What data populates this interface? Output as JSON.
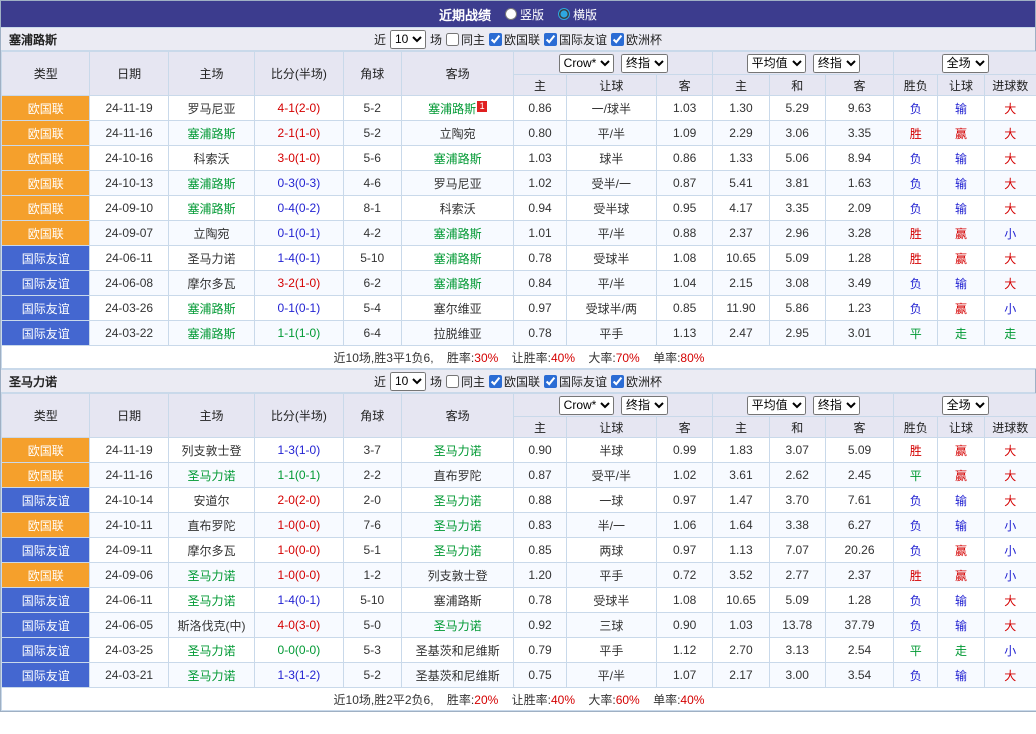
{
  "topbar": {
    "title": "近期战绩",
    "radio_vertical": "竖版",
    "radio_horizontal": "横版"
  },
  "filters": {
    "near_label": "近",
    "count_value": "10",
    "games_label": "场",
    "same_home_label": "同主",
    "comp_nations": "欧国联",
    "comp_friendly": "国际友谊",
    "comp_euro": "欧洲杯"
  },
  "selects": {
    "bookmaker": "Crow*",
    "final_odds": "终指",
    "average": "平均值",
    "full_match": "全场"
  },
  "columns": {
    "type": "类型",
    "date": "日期",
    "home": "主场",
    "score": "比分(半场)",
    "corner": "角球",
    "away": "客场",
    "ah_home": "主",
    "ah_line": "让球",
    "ah_away": "客",
    "eu_home": "主",
    "eu_draw": "和",
    "eu_away": "客",
    "wdl": "胜负",
    "handicap": "让球",
    "goals": "进球数"
  },
  "colors": {
    "topbar_bg": "#3c3c8e",
    "nations_orange": "#f5a02c",
    "friendly_blue": "#4467d0",
    "team_green": "#009933",
    "win_red": "#d40000",
    "loss_blue": "#2323d2"
  },
  "sections": [
    {
      "team": "塞浦路斯",
      "rows": [
        {
          "type": "欧国联",
          "tcls": "c-orange",
          "date": "24-11-19",
          "home": "罗马尼亚",
          "hcls": "",
          "score": "4-1(2-0)",
          "scls": "t-red",
          "corner": "5-2",
          "away": "塞浦路斯",
          "acls": "t-green",
          "badge": "1",
          "ah_h": "0.86",
          "ah_l": "一/球半",
          "ah_a": "1.03",
          "eu_h": "1.30",
          "eu_d": "5.29",
          "eu_a": "9.63",
          "wdl": "负",
          "wdlc": "t-blue",
          "hc": "输",
          "hcc": "t-blue",
          "ou": "大",
          "ouc": "t-red"
        },
        {
          "type": "欧国联",
          "tcls": "c-orange",
          "date": "24-11-16",
          "home": "塞浦路斯",
          "hcls": "t-green",
          "score": "2-1(1-0)",
          "scls": "t-red",
          "corner": "5-2",
          "away": "立陶宛",
          "acls": "",
          "ah_h": "0.80",
          "ah_l": "平/半",
          "ah_a": "1.09",
          "eu_h": "2.29",
          "eu_d": "3.06",
          "eu_a": "3.35",
          "wdl": "胜",
          "wdlc": "t-red",
          "hc": "赢",
          "hcc": "t-red",
          "ou": "大",
          "ouc": "t-red"
        },
        {
          "type": "欧国联",
          "tcls": "c-orange",
          "date": "24-10-16",
          "home": "科索沃",
          "hcls": "",
          "score": "3-0(1-0)",
          "scls": "t-red",
          "corner": "5-6",
          "away": "塞浦路斯",
          "acls": "t-green",
          "ah_h": "1.03",
          "ah_l": "球半",
          "ah_a": "0.86",
          "eu_h": "1.33",
          "eu_d": "5.06",
          "eu_a": "8.94",
          "wdl": "负",
          "wdlc": "t-blue",
          "hc": "输",
          "hcc": "t-blue",
          "ou": "大",
          "ouc": "t-red"
        },
        {
          "type": "欧国联",
          "tcls": "c-orange",
          "date": "24-10-13",
          "home": "塞浦路斯",
          "hcls": "t-green",
          "score": "0-3(0-3)",
          "scls": "t-blue",
          "corner": "4-6",
          "away": "罗马尼亚",
          "acls": "",
          "ah_h": "1.02",
          "ah_l": "受半/一",
          "ah_a": "0.87",
          "eu_h": "5.41",
          "eu_d": "3.81",
          "eu_a": "1.63",
          "wdl": "负",
          "wdlc": "t-blue",
          "hc": "输",
          "hcc": "t-blue",
          "ou": "大",
          "ouc": "t-red"
        },
        {
          "type": "欧国联",
          "tcls": "c-orange",
          "date": "24-09-10",
          "home": "塞浦路斯",
          "hcls": "t-green",
          "score": "0-4(0-2)",
          "scls": "t-blue",
          "corner": "8-1",
          "away": "科索沃",
          "acls": "",
          "ah_h": "0.94",
          "ah_l": "受半球",
          "ah_a": "0.95",
          "eu_h": "4.17",
          "eu_d": "3.35",
          "eu_a": "2.09",
          "wdl": "负",
          "wdlc": "t-blue",
          "hc": "输",
          "hcc": "t-blue",
          "ou": "大",
          "ouc": "t-red"
        },
        {
          "type": "欧国联",
          "tcls": "c-orange",
          "date": "24-09-07",
          "home": "立陶宛",
          "hcls": "",
          "score": "0-1(0-1)",
          "scls": "t-blue",
          "corner": "4-2",
          "away": "塞浦路斯",
          "acls": "t-green",
          "ah_h": "1.01",
          "ah_l": "平/半",
          "ah_a": "0.88",
          "eu_h": "2.37",
          "eu_d": "2.96",
          "eu_a": "3.28",
          "wdl": "胜",
          "wdlc": "t-red",
          "hc": "赢",
          "hcc": "t-red",
          "ou": "小",
          "ouc": "t-blue"
        },
        {
          "type": "国际友谊",
          "tcls": "c-blue",
          "date": "24-06-11",
          "home": "圣马力诺",
          "hcls": "",
          "score": "1-4(0-1)",
          "scls": "t-blue",
          "corner": "5-10",
          "away": "塞浦路斯",
          "acls": "t-green",
          "ah_h": "0.78",
          "ah_l": "受球半",
          "ah_a": "1.08",
          "eu_h": "10.65",
          "eu_d": "5.09",
          "eu_a": "1.28",
          "wdl": "胜",
          "wdlc": "t-red",
          "hc": "赢",
          "hcc": "t-red",
          "ou": "大",
          "ouc": "t-red"
        },
        {
          "type": "国际友谊",
          "tcls": "c-blue",
          "date": "24-06-08",
          "home": "摩尔多瓦",
          "hcls": "",
          "score": "3-2(1-0)",
          "scls": "t-red",
          "corner": "6-2",
          "away": "塞浦路斯",
          "acls": "t-green",
          "ah_h": "0.84",
          "ah_l": "平/半",
          "ah_a": "1.04",
          "eu_h": "2.15",
          "eu_d": "3.08",
          "eu_a": "3.49",
          "wdl": "负",
          "wdlc": "t-blue",
          "hc": "输",
          "hcc": "t-blue",
          "ou": "大",
          "ouc": "t-red"
        },
        {
          "type": "国际友谊",
          "tcls": "c-blue",
          "date": "24-03-26",
          "home": "塞浦路斯",
          "hcls": "t-green",
          "score": "0-1(0-1)",
          "scls": "t-blue",
          "corner": "5-4",
          "away": "塞尔维亚",
          "acls": "",
          "ah_h": "0.97",
          "ah_l": "受球半/两",
          "ah_a": "0.85",
          "eu_h": "11.90",
          "eu_d": "5.86",
          "eu_a": "1.23",
          "wdl": "负",
          "wdlc": "t-blue",
          "hc": "赢",
          "hcc": "t-red",
          "ou": "小",
          "ouc": "t-blue"
        },
        {
          "type": "国际友谊",
          "tcls": "c-blue",
          "date": "24-03-22",
          "home": "塞浦路斯",
          "hcls": "t-green",
          "score": "1-1(1-0)",
          "scls": "t-green",
          "corner": "6-4",
          "away": "拉脱维亚",
          "acls": "",
          "ah_h": "0.78",
          "ah_l": "平手",
          "ah_a": "1.13",
          "eu_h": "2.47",
          "eu_d": "2.95",
          "eu_a": "3.01",
          "wdl": "平",
          "wdlc": "t-green",
          "hc": "走",
          "hcc": "t-green",
          "ou": "走",
          "ouc": "t-green"
        }
      ],
      "summary": {
        "record": "近10场,胜3平1负6,",
        "win_label": "胜率:",
        "win_value": "30%",
        "hc_label": "让胜率:",
        "hc_value": "40%",
        "big_label": "大率:",
        "big_value": "70%",
        "single_label": "单率:",
        "single_value": "80%"
      }
    },
    {
      "team": "圣马力诺",
      "rows": [
        {
          "type": "欧国联",
          "tcls": "c-orange",
          "date": "24-11-19",
          "home": "列支敦士登",
          "hcls": "",
          "score": "1-3(1-0)",
          "scls": "t-blue",
          "corner": "3-7",
          "away": "圣马力诺",
          "acls": "t-green",
          "ah_h": "0.90",
          "ah_l": "半球",
          "ah_a": "0.99",
          "eu_h": "1.83",
          "eu_d": "3.07",
          "eu_a": "5.09",
          "wdl": "胜",
          "wdlc": "t-red",
          "hc": "赢",
          "hcc": "t-red",
          "ou": "大",
          "ouc": "t-red"
        },
        {
          "type": "欧国联",
          "tcls": "c-orange",
          "date": "24-11-16",
          "home": "圣马力诺",
          "hcls": "t-green",
          "score": "1-1(0-1)",
          "scls": "t-green",
          "corner": "2-2",
          "away": "直布罗陀",
          "acls": "",
          "ah_h": "0.87",
          "ah_l": "受平/半",
          "ah_a": "1.02",
          "eu_h": "3.61",
          "eu_d": "2.62",
          "eu_a": "2.45",
          "wdl": "平",
          "wdlc": "t-green",
          "hc": "赢",
          "hcc": "t-red",
          "ou": "大",
          "ouc": "t-red"
        },
        {
          "type": "国际友谊",
          "tcls": "c-blue",
          "date": "24-10-14",
          "home": "安道尔",
          "hcls": "",
          "score": "2-0(2-0)",
          "scls": "t-red",
          "corner": "2-0",
          "away": "圣马力诺",
          "acls": "t-green",
          "ah_h": "0.88",
          "ah_l": "一球",
          "ah_a": "0.97",
          "eu_h": "1.47",
          "eu_d": "3.70",
          "eu_a": "7.61",
          "wdl": "负",
          "wdlc": "t-blue",
          "hc": "输",
          "hcc": "t-blue",
          "ou": "大",
          "ouc": "t-red"
        },
        {
          "type": "欧国联",
          "tcls": "c-orange",
          "date": "24-10-11",
          "home": "直布罗陀",
          "hcls": "",
          "score": "1-0(0-0)",
          "scls": "t-red",
          "corner": "7-6",
          "away": "圣马力诺",
          "acls": "t-green",
          "ah_h": "0.83",
          "ah_l": "半/一",
          "ah_a": "1.06",
          "eu_h": "1.64",
          "eu_d": "3.38",
          "eu_a": "6.27",
          "wdl": "负",
          "wdlc": "t-blue",
          "hc": "输",
          "hcc": "t-blue",
          "ou": "小",
          "ouc": "t-blue"
        },
        {
          "type": "国际友谊",
          "tcls": "c-blue",
          "date": "24-09-11",
          "home": "摩尔多瓦",
          "hcls": "",
          "score": "1-0(0-0)",
          "scls": "t-red",
          "corner": "5-1",
          "away": "圣马力诺",
          "acls": "t-green",
          "ah_h": "0.85",
          "ah_l": "两球",
          "ah_a": "0.97",
          "eu_h": "1.13",
          "eu_d": "7.07",
          "eu_a": "20.26",
          "wdl": "负",
          "wdlc": "t-blue",
          "hc": "赢",
          "hcc": "t-red",
          "ou": "小",
          "ouc": "t-blue"
        },
        {
          "type": "欧国联",
          "tcls": "c-orange",
          "date": "24-09-06",
          "home": "圣马力诺",
          "hcls": "t-green",
          "score": "1-0(0-0)",
          "scls": "t-red",
          "corner": "1-2",
          "away": "列支敦士登",
          "acls": "",
          "ah_h": "1.20",
          "ah_l": "平手",
          "ah_a": "0.72",
          "eu_h": "3.52",
          "eu_d": "2.77",
          "eu_a": "2.37",
          "wdl": "胜",
          "wdlc": "t-red",
          "hc": "赢",
          "hcc": "t-red",
          "ou": "小",
          "ouc": "t-blue"
        },
        {
          "type": "国际友谊",
          "tcls": "c-blue",
          "date": "24-06-11",
          "home": "圣马力诺",
          "hcls": "t-green",
          "score": "1-4(0-1)",
          "scls": "t-blue",
          "corner": "5-10",
          "away": "塞浦路斯",
          "acls": "",
          "ah_h": "0.78",
          "ah_l": "受球半",
          "ah_a": "1.08",
          "eu_h": "10.65",
          "eu_d": "5.09",
          "eu_a": "1.28",
          "wdl": "负",
          "wdlc": "t-blue",
          "hc": "输",
          "hcc": "t-blue",
          "ou": "大",
          "ouc": "t-red"
        },
        {
          "type": "国际友谊",
          "tcls": "c-blue",
          "date": "24-06-05",
          "home": "斯洛伐克(中)",
          "hcls": "",
          "score": "4-0(3-0)",
          "scls": "t-red",
          "corner": "5-0",
          "away": "圣马力诺",
          "acls": "t-green",
          "ah_h": "0.92",
          "ah_l": "三球",
          "ah_a": "0.90",
          "eu_h": "1.03",
          "eu_d": "13.78",
          "eu_a": "37.79",
          "wdl": "负",
          "wdlc": "t-blue",
          "hc": "输",
          "hcc": "t-blue",
          "ou": "大",
          "ouc": "t-red"
        },
        {
          "type": "国际友谊",
          "tcls": "c-blue",
          "date": "24-03-25",
          "home": "圣马力诺",
          "hcls": "t-green",
          "score": "0-0(0-0)",
          "scls": "t-green",
          "corner": "5-3",
          "away": "圣基茨和尼维斯",
          "acls": "",
          "ah_h": "0.79",
          "ah_l": "平手",
          "ah_a": "1.12",
          "eu_h": "2.70",
          "eu_d": "3.13",
          "eu_a": "2.54",
          "wdl": "平",
          "wdlc": "t-green",
          "hc": "走",
          "hcc": "t-green",
          "ou": "小",
          "ouc": "t-blue"
        },
        {
          "type": "国际友谊",
          "tcls": "c-blue",
          "date": "24-03-21",
          "home": "圣马力诺",
          "hcls": "t-green",
          "score": "1-3(1-2)",
          "scls": "t-blue",
          "corner": "5-2",
          "away": "圣基茨和尼维斯",
          "acls": "",
          "ah_h": "0.75",
          "ah_l": "平/半",
          "ah_a": "1.07",
          "eu_h": "2.17",
          "eu_d": "3.00",
          "eu_a": "3.54",
          "wdl": "负",
          "wdlc": "t-blue",
          "hc": "输",
          "hcc": "t-blue",
          "ou": "大",
          "ouc": "t-red"
        }
      ],
      "summary": {
        "record": "近10场,胜2平2负6,",
        "win_label": "胜率:",
        "win_value": "20%",
        "hc_label": "让胜率:",
        "hc_value": "40%",
        "big_label": "大率:",
        "big_value": "60%",
        "single_label": "单率:",
        "single_value": "40%"
      }
    }
  ]
}
